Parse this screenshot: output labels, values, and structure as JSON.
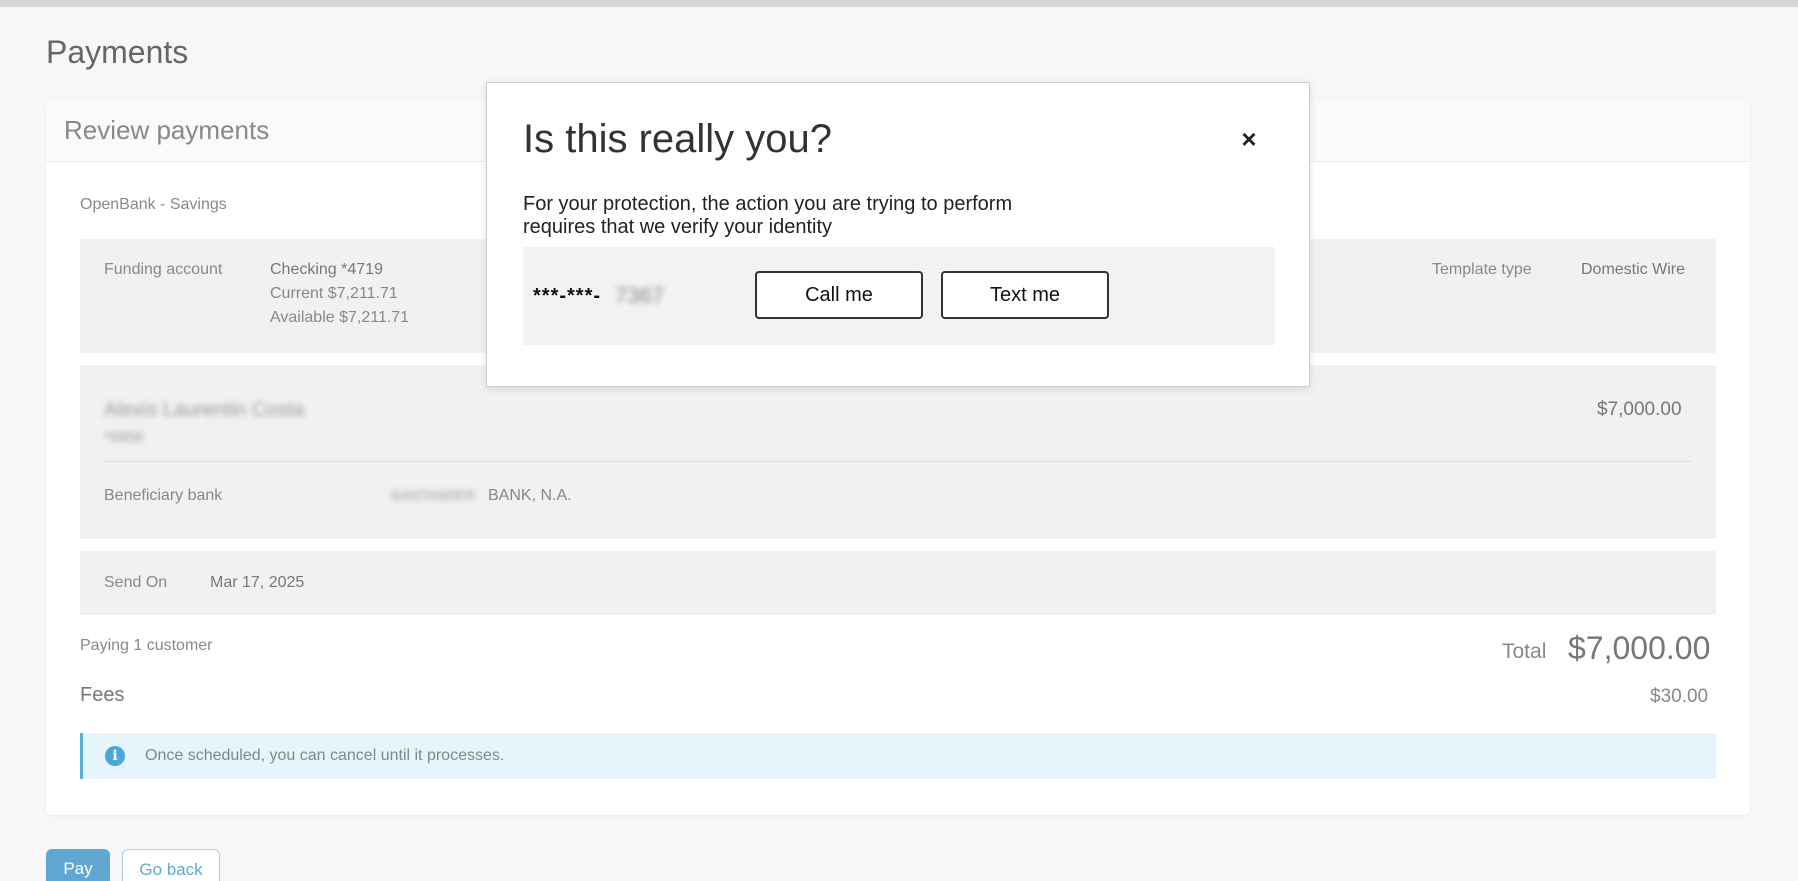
{
  "page": {
    "title": "Payments"
  },
  "review": {
    "title": "Review payments",
    "bank_name": "OpenBank - Savings",
    "funding": {
      "label": "Funding account",
      "account": "Checking *4719",
      "current": "Current $7,211.71",
      "available": "Available $7,211.71",
      "template_type_label": "Template type",
      "template_type_value": "Domestic Wire"
    },
    "beneficiary": {
      "name": "Alexis Laurentin Costa",
      "account": "*9958",
      "amount": "$7,000.00",
      "bank_label": "Beneficiary bank",
      "bank_name_blurred": "SANTANDER",
      "bank_name_suffix": "BANK, N.A."
    },
    "send_on": {
      "label": "Send On",
      "value": "Mar 17, 2025"
    },
    "summary": {
      "paying": "Paying 1 customer",
      "total_label": "Total",
      "total_value": "$7,000.00",
      "fees_label": "Fees",
      "fees_value": "$30.00"
    },
    "info": {
      "icon": "info-icon",
      "text": "Once scheduled, you can cancel until it processes."
    }
  },
  "actions": {
    "pay": "Pay",
    "go_back": "Go back"
  },
  "modal": {
    "title": "Is this really you?",
    "close_icon": "×",
    "desc_line1": "For your protection, the action you are trying to perform",
    "desc_line2": "requires that we verify your identity",
    "phone_prefix": "***-***-",
    "phone_masked": "7367",
    "call_button": "Call me",
    "text_button": "Text me"
  }
}
